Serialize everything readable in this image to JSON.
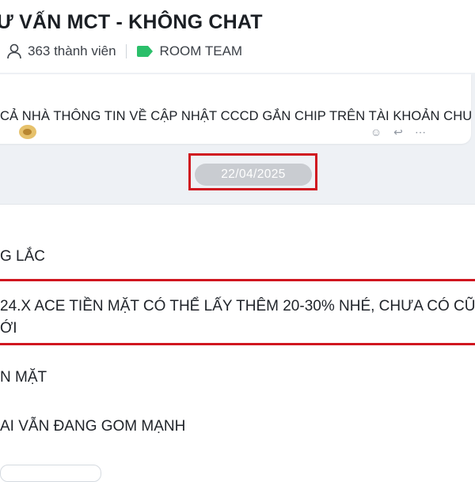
{
  "header": {
    "title": "Ư VẤN MCT - KHÔNG CHAT",
    "members": "363 thành viên",
    "tag": "ROOM TEAM"
  },
  "pinned": {
    "text": "CẢ NHÀ  THÔNG TIN VỀ CẬP NHẬT CCCD GẮN CHIP TRÊN TÀI KHOẢN CHU"
  },
  "chat": {
    "date": "22/04/2025"
  },
  "messages": [
    {
      "text": "G LẮC"
    },
    {
      "text": "24.X ACE TIỀN MẶT CÓ THỂ LẤY THÊM 20-30% NHÉ, CHƯA CÓ CŨ",
      "continuation": "ỚI"
    },
    {
      "text": "N MẶT"
    },
    {
      "text": "AI VẪN ĐANG GOM MẠNH"
    }
  ],
  "colors": {
    "highlight_border": "#d0161f",
    "tag_icon": "#2bbf6a",
    "date_chip_bg": "#c9ccd1",
    "chat_bg": "#eef1f5"
  },
  "icons": [
    "person-icon",
    "tag-icon",
    "reaction-icon",
    "reply-icon",
    "more-icon"
  ]
}
